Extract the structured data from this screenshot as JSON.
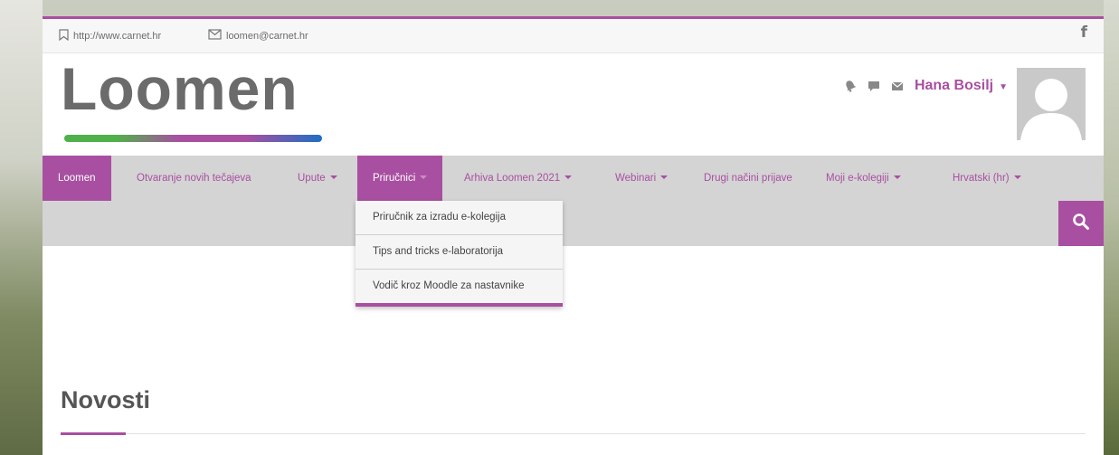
{
  "colors": {
    "accent": "#a94fa1",
    "nav_bg": "#d4d4d4",
    "logo_text": "#6b6b6b"
  },
  "infobar": {
    "url_icon": "bookmark-icon",
    "url": "http://www.carnet.hr",
    "mail_icon": "envelope-icon",
    "email": "loomen@carnet.hr",
    "social_icon": "facebook-icon",
    "social_glyph": "f"
  },
  "header": {
    "logo_text": "Loomen",
    "icons": [
      "bell-icon",
      "comment-icon",
      "envelope-icon"
    ],
    "user_name": "Hana Bosilj",
    "avatar_icon": "default-user-avatar"
  },
  "nav": {
    "items": [
      {
        "label": "Loomen",
        "has_caret": false,
        "state": "active"
      },
      {
        "label": "Otvaranje novih tečajeva",
        "has_caret": false,
        "state": "normal"
      },
      {
        "label": "Upute",
        "has_caret": true,
        "state": "normal"
      },
      {
        "label": "Priručnici",
        "has_caret": true,
        "state": "open"
      },
      {
        "label": "Arhiva Loomen 2021",
        "has_caret": true,
        "state": "normal"
      },
      {
        "label": "Webinari",
        "has_caret": true,
        "state": "normal"
      },
      {
        "label": "Drugi načini prijave",
        "has_caret": false,
        "state": "normal"
      },
      {
        "label": "Moji e-kolegiji",
        "has_caret": true,
        "state": "normal"
      },
      {
        "label": "Hrvatski (hr)",
        "has_caret": true,
        "state": "normal"
      }
    ],
    "search_icon": "search-icon"
  },
  "dropdown": {
    "items": [
      "Priručnik za izradu e-kolegija",
      "Tips and tricks e-laboratorija",
      "Vodič kroz Moodle za nastavnike"
    ]
  },
  "main": {
    "section_title": "Novosti"
  }
}
